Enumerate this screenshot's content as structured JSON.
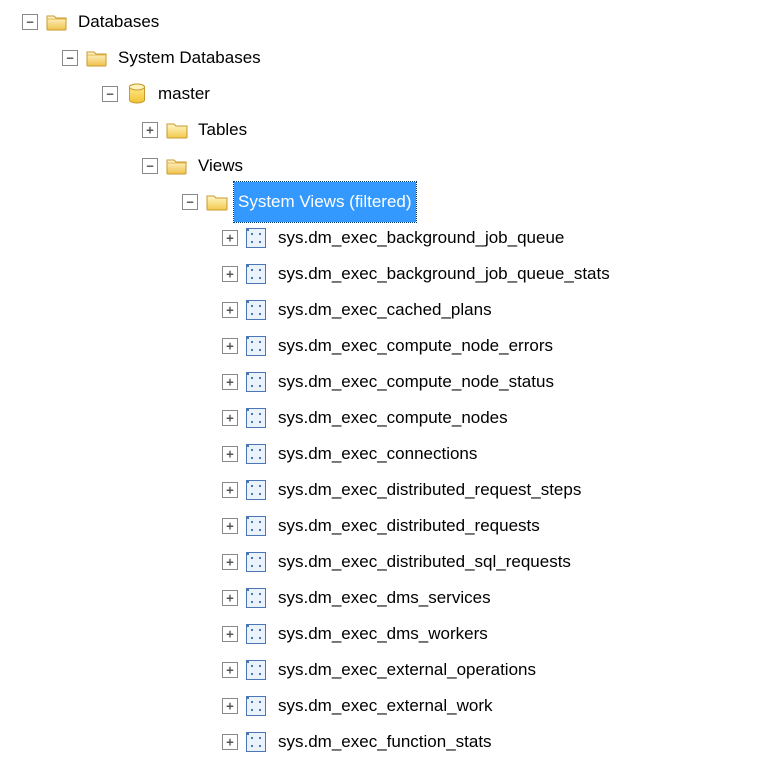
{
  "tree": {
    "databases_label": "Databases",
    "system_databases_label": "System Databases",
    "master_label": "master",
    "tables_label": "Tables",
    "views_label": "Views",
    "system_views_label": "System Views (filtered)",
    "view_items": [
      "sys.dm_exec_background_job_queue",
      "sys.dm_exec_background_job_queue_stats",
      "sys.dm_exec_cached_plans",
      "sys.dm_exec_compute_node_errors",
      "sys.dm_exec_compute_node_status",
      "sys.dm_exec_compute_nodes",
      "sys.dm_exec_connections",
      "sys.dm_exec_distributed_request_steps",
      "sys.dm_exec_distributed_requests",
      "sys.dm_exec_distributed_sql_requests",
      "sys.dm_exec_dms_services",
      "sys.dm_exec_dms_workers",
      "sys.dm_exec_external_operations",
      "sys.dm_exec_external_work",
      "sys.dm_exec_function_stats"
    ]
  }
}
